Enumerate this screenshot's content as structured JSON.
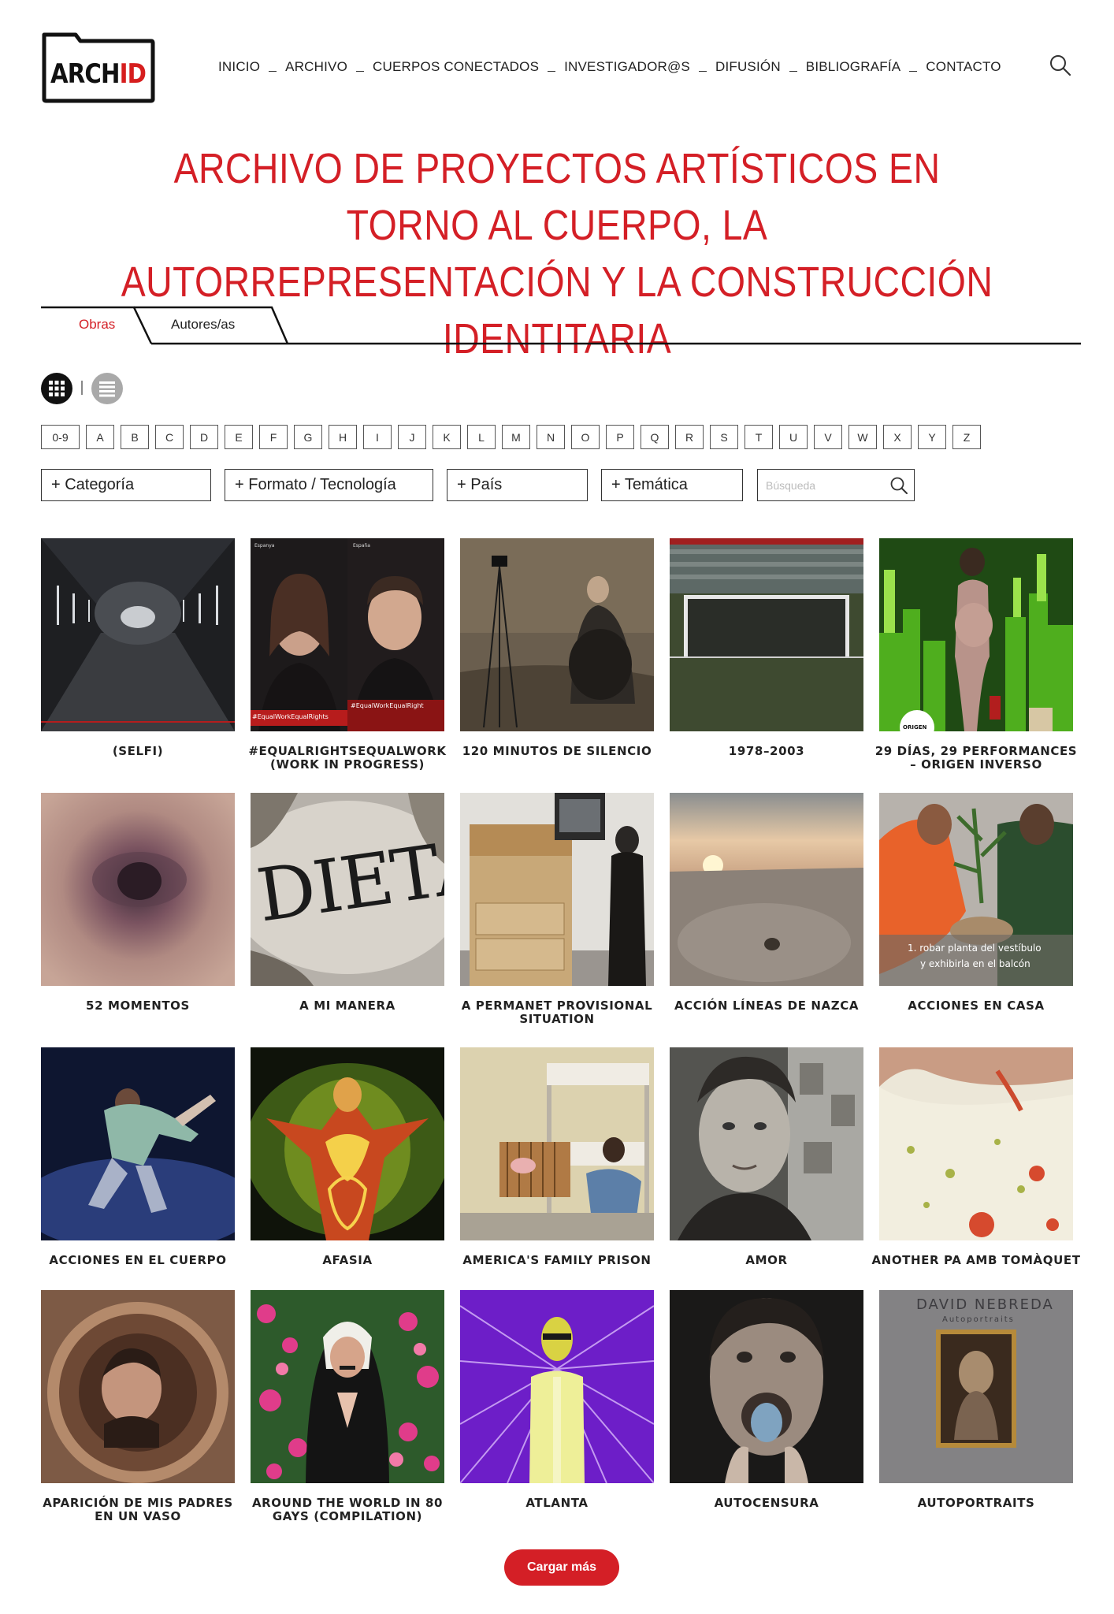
{
  "logo": {
    "text_a": "ARCH",
    "text_b": "ID"
  },
  "nav": [
    {
      "label": "INICIO"
    },
    {
      "label": "ARCHIVO"
    },
    {
      "label": "CUERPOS CONECTADOS"
    },
    {
      "label": "INVESTIGADOR@S"
    },
    {
      "label": "DIFUSIÓN"
    },
    {
      "label": "BIBLIOGRAFÍA"
    },
    {
      "label": "CONTACTO"
    }
  ],
  "hero": {
    "line1": "ARCHIVO DE PROYECTOS ARTÍSTICOS EN TORNO AL CUERPO, LA",
    "line2": "AUTORREPRESENTACIÓN Y LA CONSTRUCCIÓN IDENTITARIA"
  },
  "tabs": {
    "active": "Obras",
    "inactive": "Autores/as"
  },
  "alphabet": [
    "0-9",
    "A",
    "B",
    "C",
    "D",
    "E",
    "F",
    "G",
    "H",
    "I",
    "J",
    "K",
    "L",
    "M",
    "N",
    "O",
    "P",
    "Q",
    "R",
    "S",
    "T",
    "U",
    "V",
    "W",
    "X",
    "Y",
    "Z"
  ],
  "filters": {
    "categoria": "+ Categoría",
    "formato": "+ Formato / Tecnología",
    "pais": "+ País",
    "tematica": "+ Temática",
    "search_placeholder": "Búsqueda"
  },
  "works": [
    {
      "title": "(SELFI)"
    },
    {
      "title": "#EQUALRIGHTSEQUALWORK (WORK IN PROGRESS)"
    },
    {
      "title": "120 MINUTOS DE SILENCIO"
    },
    {
      "title": "1978–2003"
    },
    {
      "title": "29 DÍAS, 29 PERFORMANCES – ORIGEN INVERSO"
    },
    {
      "title": "52 MOMENTOS"
    },
    {
      "title": "A MI MANERA"
    },
    {
      "title": "A PERMANET PROVISIONAL SITUATION"
    },
    {
      "title": "ACCIÓN LÍNEAS DE NAZCA"
    },
    {
      "title": "ACCIONES EN CASA"
    },
    {
      "title": "ACCIONES EN EL CUERPO"
    },
    {
      "title": "AFASIA"
    },
    {
      "title": "AMERICA'S FAMILY PRISON"
    },
    {
      "title": "AMOR"
    },
    {
      "title": "ANOTHER PA AMB TOMÀQUET"
    },
    {
      "title": "APARICIÓN DE MIS PADRES EN UN VASO"
    },
    {
      "title": "AROUND THE WORLD IN 80 GAYS (COMPILATION)"
    },
    {
      "title": "ATLANTA"
    },
    {
      "title": "AUTOCENSURA"
    },
    {
      "title": "AUTOPORTRAITS"
    }
  ],
  "thumb_text": {
    "poster_left_top": "Espanya",
    "poster_left_hash": "#EqualWorkEqualRights",
    "poster_right_top": "España",
    "poster_right_hash": "#EqualWorkEqualRight",
    "dieta": "DIETA",
    "origen": "ORIGEN",
    "acciones_caption_1": "1. robar planta del vestíbulo",
    "acciones_caption_2": "y exhibirla en el balcón",
    "book_author": "DAVID NEBREDA",
    "book_title": "Autoportraits"
  },
  "load_more": "Cargar más"
}
